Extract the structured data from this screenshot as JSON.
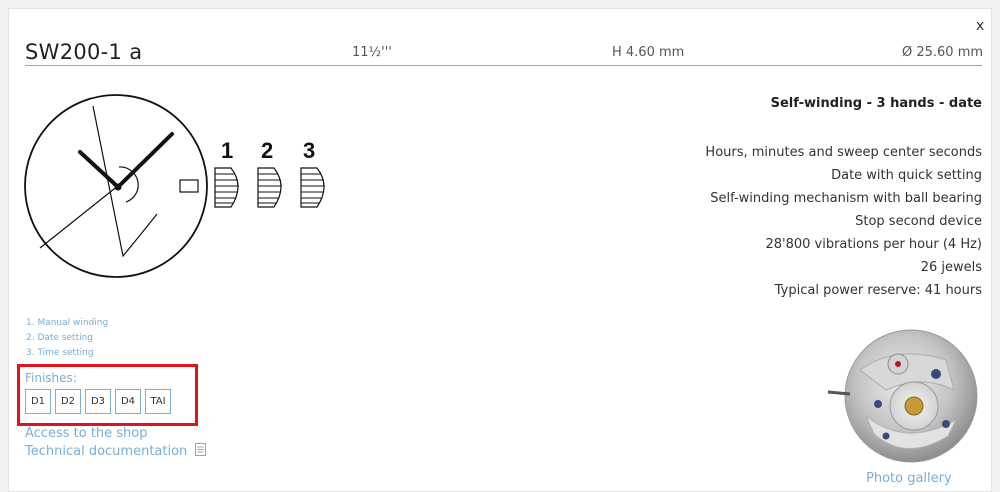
{
  "header": {
    "close_label": "x",
    "model": "SW200-1 a",
    "size": "11½'''",
    "height": "H 4.60 mm",
    "diameter": "Ø 25.60 mm"
  },
  "headline": "Self-winding - 3 hands - date",
  "features": [
    "Hours, minutes and sweep center seconds",
    "Date with quick setting",
    "Self-winding mechanism with ball bearing",
    "Stop second device",
    "28'800 vibrations per hour (4 Hz)",
    "26 jewels",
    "Typical power reserve: 41 hours"
  ],
  "crown_positions": [
    "1",
    "2",
    "3"
  ],
  "notes": [
    "1. Manual winding",
    "2. Date setting",
    "3. Time setting"
  ],
  "finishes": {
    "label": "Finishes:",
    "options": [
      "D1",
      "D2",
      "D3",
      "D4",
      "TAI"
    ]
  },
  "links": {
    "shop": "Access to the shop",
    "docs": "Technical documentation"
  },
  "gallery_label": "Photo gallery",
  "colors": {
    "accent": "#7aaed6",
    "highlight": "#e0131a",
    "text": "#222222"
  },
  "icons": [
    "close-icon",
    "document-icon",
    "watch-diagram",
    "movement-photo"
  ]
}
